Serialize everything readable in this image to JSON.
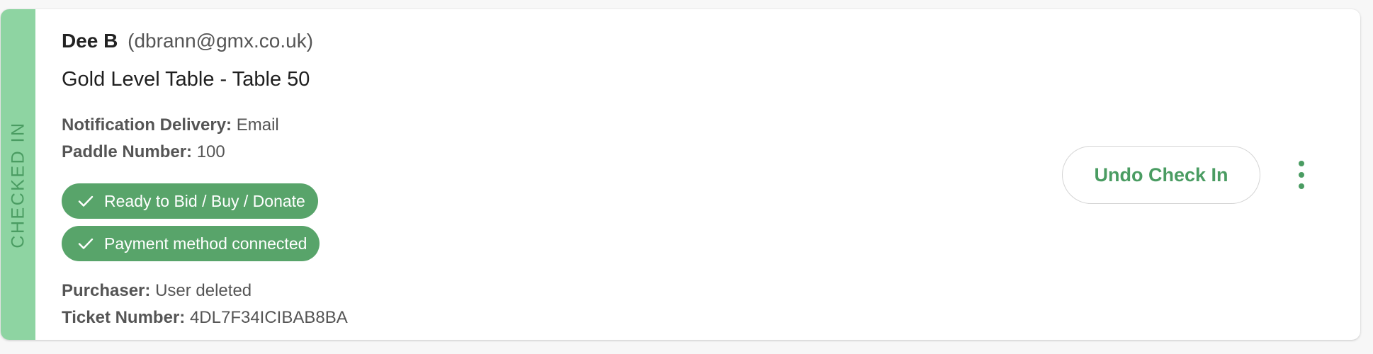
{
  "status": {
    "label": "CHECKED IN",
    "strip_color": "#8ed4a2",
    "text_color": "#4a9c62"
  },
  "guest": {
    "name": "Dee B",
    "email": "(dbrann@gmx.co.uk)",
    "ticket_title": "Gold Level Table - Table 50"
  },
  "details": {
    "notification_label": "Notification Delivery:",
    "notification_value": "Email",
    "paddle_label": "Paddle Number:",
    "paddle_value": "100",
    "purchaser_label": "Purchaser:",
    "purchaser_value": "User deleted",
    "ticket_number_label": "Ticket Number:",
    "ticket_number_value": "4DL7F34ICIBAB8BA"
  },
  "badges": [
    {
      "label": "Ready to Bid / Buy / Donate",
      "icon": "check-icon"
    },
    {
      "label": "Payment method connected",
      "icon": "check-icon"
    }
  ],
  "badge_color": "#58a46a",
  "actions": {
    "undo_label": "Undo Check In",
    "more_icon": "more-vertical-icon"
  }
}
